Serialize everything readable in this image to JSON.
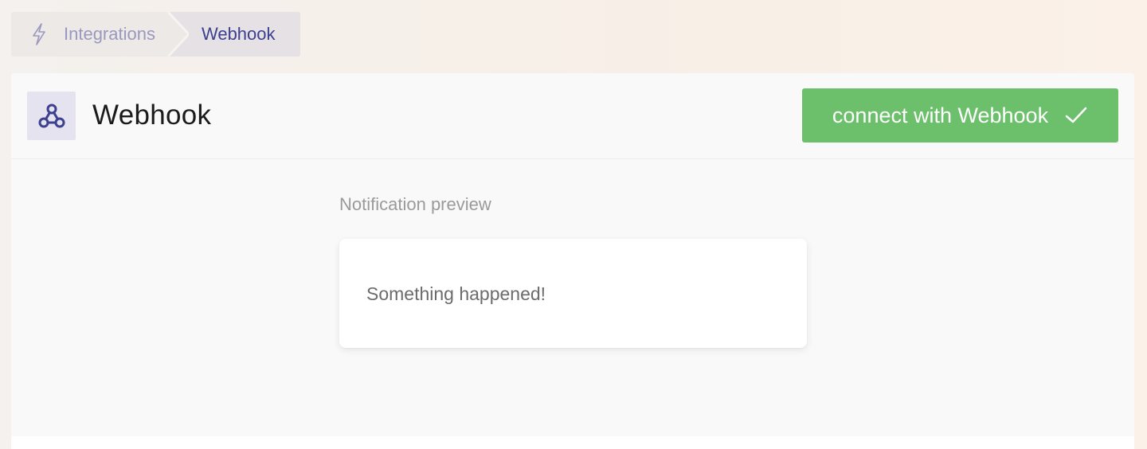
{
  "breadcrumb": {
    "root_label": "Integrations",
    "root_icon": "lightning-bolt-icon",
    "current_label": "Webhook"
  },
  "header": {
    "app_icon": "webhook-icon",
    "title": "Webhook",
    "connect_button_label": "connect with Webhook",
    "connect_button_icon": "checkmark-icon"
  },
  "preview": {
    "label": "Notification preview",
    "message": "Something happened!"
  },
  "colors": {
    "accent": "#3d3f8f",
    "connect_button": "#6cc06b",
    "breadcrumb_root_text": "#9b98bf"
  }
}
